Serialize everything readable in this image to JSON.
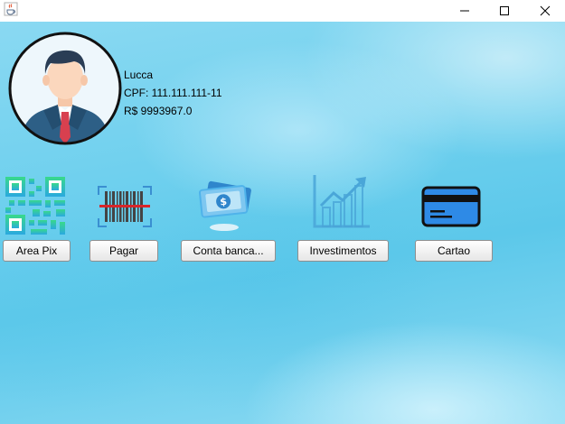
{
  "window": {
    "icons": {
      "app": "java-cup-icon",
      "minimize": "minimize-icon",
      "maximize": "maximize-icon",
      "close": "close-icon"
    }
  },
  "user": {
    "name": "Lucca",
    "cpf": "CPF: 111.111.111-11",
    "balance": "R$ 9993967.0",
    "avatar_icon": "businessman-avatar-icon"
  },
  "actions": [
    {
      "label": "Area Pix",
      "icon": "qr-code-icon"
    },
    {
      "label": "Pagar",
      "icon": "barcode-scan-icon"
    },
    {
      "label": "Conta banca...",
      "icon": "money-bills-icon"
    },
    {
      "label": "Investimentos",
      "icon": "growth-chart-icon"
    },
    {
      "label": "Cartao",
      "icon": "credit-card-icon"
    }
  ],
  "colors": {
    "background": "#6fd0ee",
    "card_blue": "#2e8ae6",
    "barcode_red": "#d8262a",
    "money_blue": "#4fb3ea",
    "chart_blue": "#4aa6d8"
  }
}
